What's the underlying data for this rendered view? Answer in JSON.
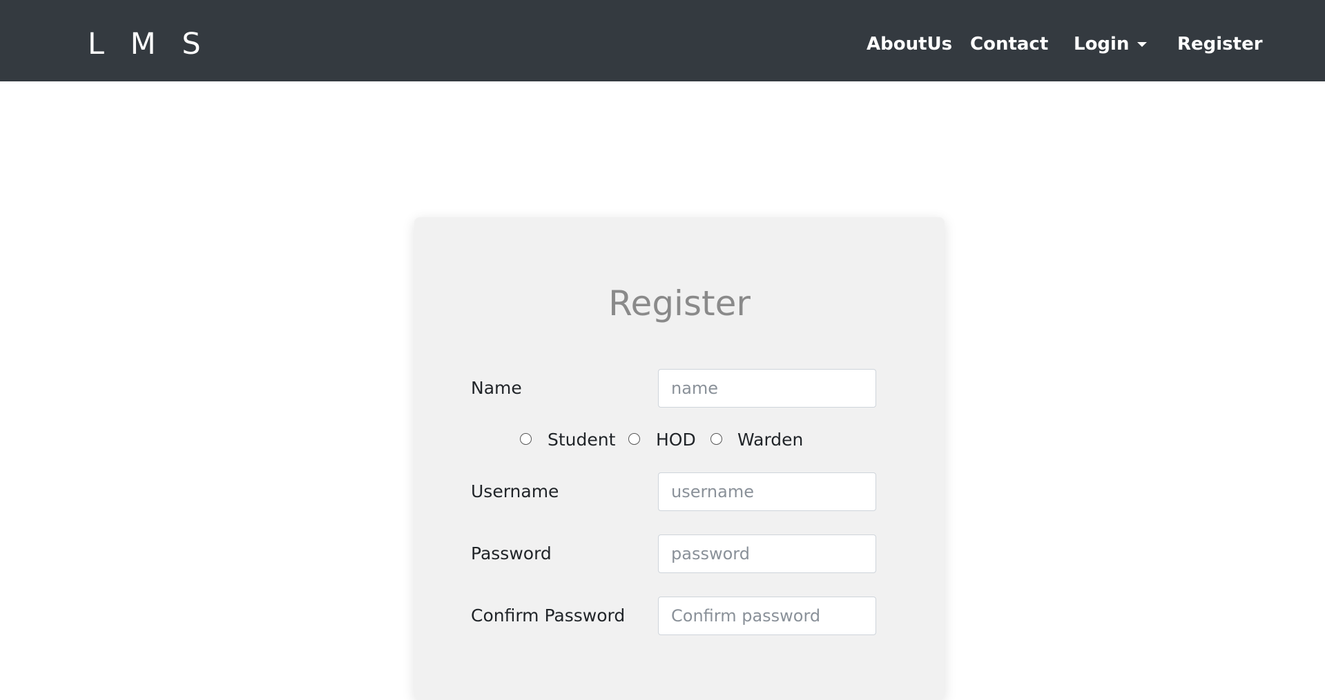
{
  "navbar": {
    "brand": "L M S",
    "links": {
      "about": "AboutUs",
      "contact": "Contact",
      "login": "Login",
      "register": "Register"
    },
    "colors": {
      "background": "#343a40",
      "text": "#ffffff"
    }
  },
  "form": {
    "title": "Register",
    "name": {
      "label": "Name",
      "placeholder": "name"
    },
    "roles": {
      "student": "Student",
      "hod": "HOD",
      "warden": "Warden"
    },
    "username": {
      "label": "Username",
      "placeholder": "username"
    },
    "password": {
      "label": "Password",
      "placeholder": "password"
    },
    "confirm_password": {
      "label": "Confirm Password",
      "placeholder": "Confirm password"
    },
    "colors": {
      "card_background": "#f1f1f1",
      "title": "#8a8a8a"
    }
  }
}
